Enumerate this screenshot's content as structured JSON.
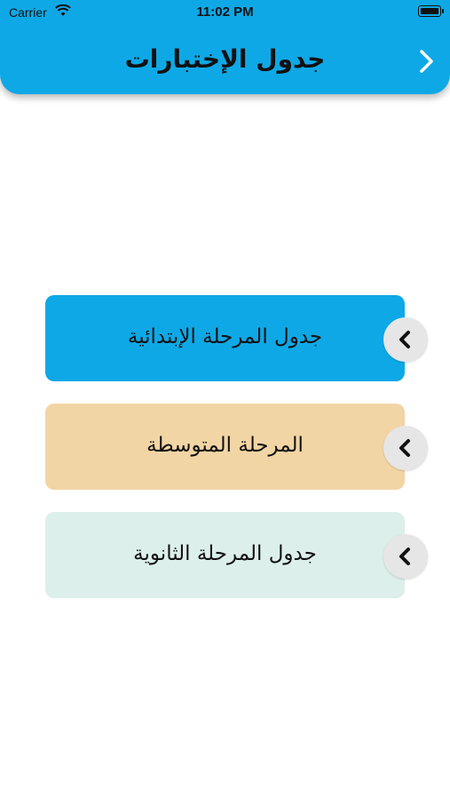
{
  "status_bar": {
    "carrier": "Carrier",
    "time": "11:02 PM"
  },
  "header": {
    "title": "جدول الإختبارات",
    "color": "#0fa8e6",
    "back_icon": "chevron-right-icon"
  },
  "cards": [
    {
      "label": "جدول المرحلة الإبتدائية",
      "color": "#0fa8e6",
      "icon": "chevron-left-icon"
    },
    {
      "label": "المرحلة المتوسطة",
      "color": "#f2d5a5",
      "icon": "chevron-left-icon"
    },
    {
      "label": "جدول المرحلة الثانوية",
      "color": "#dcefeb",
      "icon": "chevron-left-icon"
    }
  ]
}
